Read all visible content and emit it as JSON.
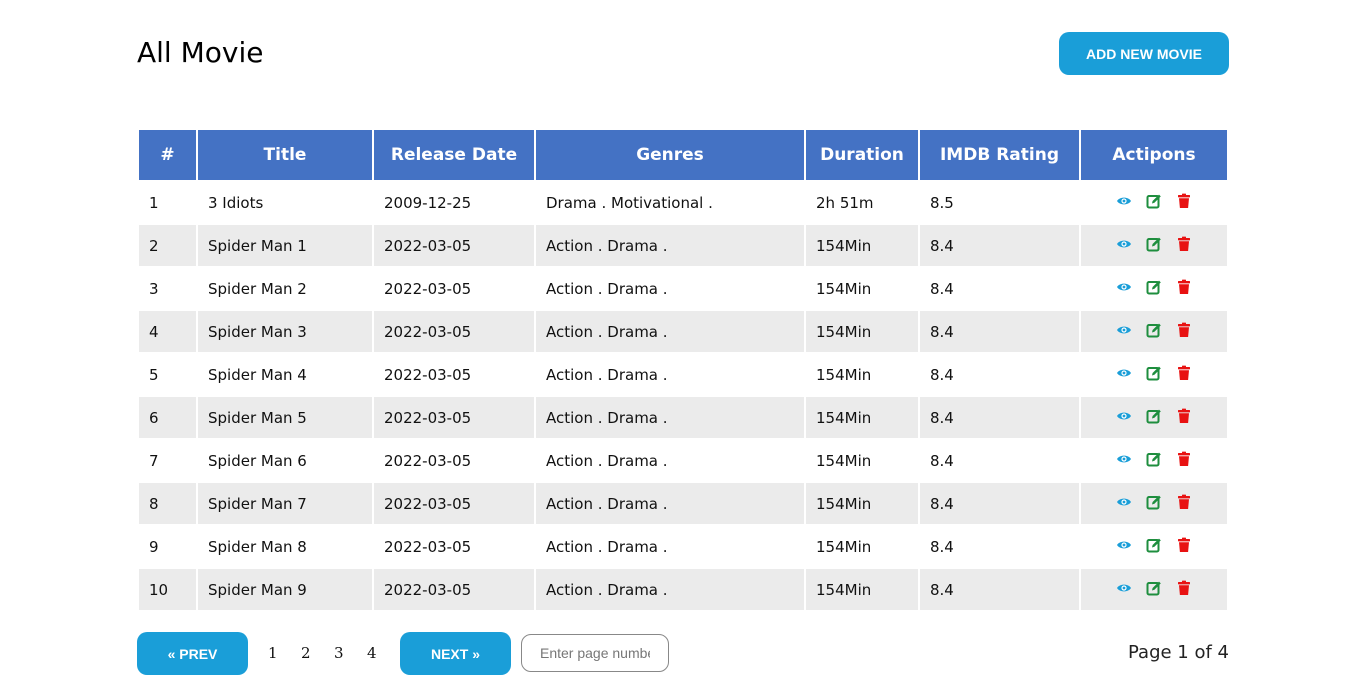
{
  "header": {
    "title": "All Movie",
    "add_button": "ADD NEW MOVIE"
  },
  "table": {
    "columns": [
      "#",
      "Title",
      "Release Date",
      "Genres",
      "Duration",
      "IMDB Rating",
      "Actipons"
    ],
    "rows": [
      {
        "num": "1",
        "title": "3 Idiots",
        "release": "2009-12-25",
        "genres": "Drama . Motivational .",
        "duration": "2h 51m",
        "rating": "8.5"
      },
      {
        "num": "2",
        "title": "Spider Man 1",
        "release": "2022-03-05",
        "genres": "Action . Drama .",
        "duration": "154Min",
        "rating": "8.4"
      },
      {
        "num": "3",
        "title": "Spider Man 2",
        "release": "2022-03-05",
        "genres": "Action . Drama .",
        "duration": "154Min",
        "rating": "8.4"
      },
      {
        "num": "4",
        "title": "Spider Man 3",
        "release": "2022-03-05",
        "genres": "Action . Drama .",
        "duration": "154Min",
        "rating": "8.4"
      },
      {
        "num": "5",
        "title": "Spider Man 4",
        "release": "2022-03-05",
        "genres": "Action . Drama .",
        "duration": "154Min",
        "rating": "8.4"
      },
      {
        "num": "6",
        "title": "Spider Man 5",
        "release": "2022-03-05",
        "genres": "Action . Drama .",
        "duration": "154Min",
        "rating": "8.4"
      },
      {
        "num": "7",
        "title": "Spider Man 6",
        "release": "2022-03-05",
        "genres": "Action . Drama .",
        "duration": "154Min",
        "rating": "8.4"
      },
      {
        "num": "8",
        "title": "Spider Man 7",
        "release": "2022-03-05",
        "genres": "Action . Drama .",
        "duration": "154Min",
        "rating": "8.4"
      },
      {
        "num": "9",
        "title": "Spider Man 8",
        "release": "2022-03-05",
        "genres": "Action . Drama .",
        "duration": "154Min",
        "rating": "8.4"
      },
      {
        "num": "10",
        "title": "Spider Man 9",
        "release": "2022-03-05",
        "genres": "Action . Drama .",
        "duration": "154Min",
        "rating": "8.4"
      }
    ],
    "action_icons": [
      "eye-icon",
      "edit-icon",
      "trash-icon"
    ]
  },
  "pagination": {
    "prev_label": "« PREV",
    "next_label": "NEXT »",
    "pages": [
      "1",
      "2",
      "3",
      "4"
    ],
    "input_placeholder": "Enter page number",
    "info": "Page 1 of 4"
  },
  "colors": {
    "accent": "#1a9ed8",
    "header_bg": "#4472c4",
    "row_alt": "#ebebeb",
    "view_icon": "#1a9ed8",
    "edit_icon": "#1e8e3e",
    "delete_icon": "#e81212"
  }
}
